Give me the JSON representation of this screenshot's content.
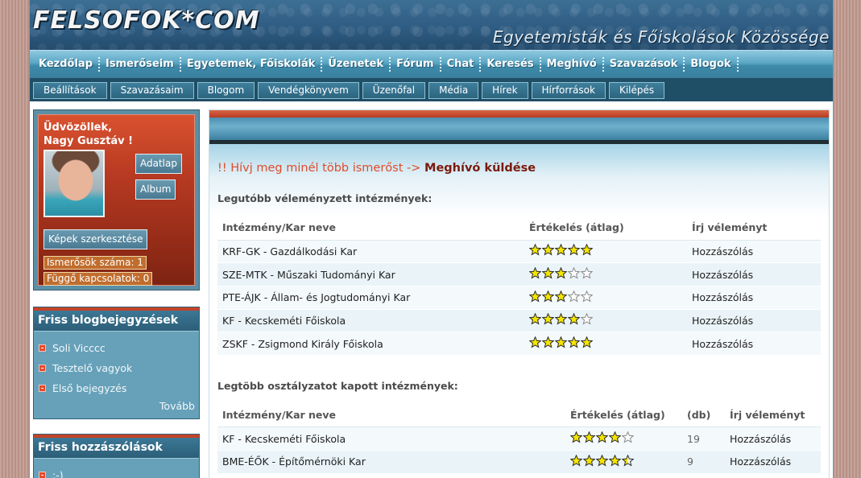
{
  "header": {
    "logo_text": "FELSOFOK*COM",
    "slogan": "Egyetemisták és Főiskolások Közössége"
  },
  "main_nav": [
    "Kezdőlap",
    "Ismerőseim",
    "Egyetemek, Főiskolák",
    "Üzenetek",
    "Fórum",
    "Chat",
    "Keresés",
    "Meghívó",
    "Szavazások",
    "Blogok"
  ],
  "sub_nav": [
    "Beállítások",
    "Szavazásaim",
    "Blogom",
    "Vendégkönyvem",
    "Üzenőfal",
    "Média",
    "Hírek",
    "Hírforrások",
    "Kilépés"
  ],
  "user": {
    "greeting_line1": "Üdvözöllek,",
    "greeting_line2": "Nagy Gusztáv !",
    "profile_button": "Adatlap",
    "album_button": "Album",
    "edit_photos_button": "Képek szerkesztése",
    "friends_count": "Ismerősök száma: 1",
    "pending_connections": "Függő kapcsolatok: 0"
  },
  "blog_box": {
    "title": "Friss blogbejegyzések",
    "items": [
      "Soli Vicccc",
      "Tesztelő vagyok",
      "Első bejegyzés"
    ],
    "more": "Tovább"
  },
  "comments_box": {
    "title": "Friss hozzászólások",
    "items": [
      ":-)"
    ]
  },
  "main": {
    "invite_text": "!! Hívj meg minél több ismerőst ->",
    "invite_link": "Meghívó küldése",
    "recent_title": "Legutóbb véleményzett intézmények:",
    "recent_headers": [
      "Intézmény/Kar neve",
      "Értékelés (átlag)",
      "Írj véleményt"
    ],
    "recent_rows": [
      {
        "name": "KRF-GK - Gazdálkodási Kar",
        "rating": 5,
        "action": "Hozzászólás"
      },
      {
        "name": "SZE-MTK - Műszaki Tudományi Kar",
        "rating": 3,
        "action": "Hozzászólás"
      },
      {
        "name": "PTE-ÁJK - Állam- és Jogtudományi Kar",
        "rating": 3,
        "action": "Hozzászólás"
      },
      {
        "name": "KF - Kecskeméti Főiskola",
        "rating": 4,
        "action": "Hozzászólás"
      },
      {
        "name": "ZSKF - Zsigmond Király Főiskola",
        "rating": 5,
        "action": "Hozzászólás"
      }
    ],
    "most_title": "Legtöbb osztályzatot kapott intézmények:",
    "most_headers": [
      "Intézmény/Kar neve",
      "Értékelés (átlag)",
      "(db)",
      "Írj véleményt"
    ],
    "most_rows": [
      {
        "name": "KF - Kecskeméti Főiskola",
        "rating": 4,
        "count": "19",
        "action": "Hozzászólás"
      },
      {
        "name": "BME-ÉŐK - Építőmérnöki Kar",
        "rating": 4.5,
        "count": "9",
        "action": "Hozzászólás"
      }
    ]
  },
  "colors": {
    "star_fill": "#f5e400",
    "star_outline": "#3a3a3a",
    "accent_red": "#c44327",
    "nav_teal": "#3e8aaa"
  }
}
